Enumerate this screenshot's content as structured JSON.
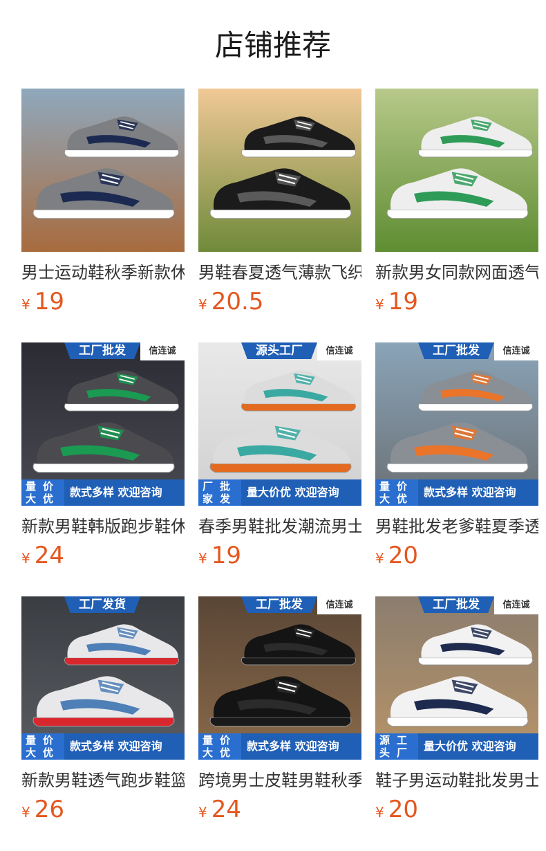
{
  "title": "店铺推荐",
  "currency": "¥",
  "colors": {
    "price": "#e4571f",
    "badge": "#1f5fb6"
  },
  "products": [
    {
      "name": "男士运动鞋秋季新款休闲跑步鞋",
      "price": "19",
      "badge_top": "",
      "badge_trust": "",
      "badge_left": "",
      "badge_right": "",
      "scene": "mountain",
      "shoe": "navy-grey"
    },
    {
      "name": "男鞋春夏透气薄款飞织运动鞋",
      "price": "20.5",
      "badge_top": "",
      "badge_trust": "",
      "badge_left": "",
      "badge_right": "",
      "scene": "sunset",
      "shoe": "black-white"
    },
    {
      "name": "新款男女同款网面透气运动鞋",
      "price": "19",
      "badge_top": "",
      "badge_trust": "",
      "badge_left": "",
      "badge_right": "",
      "scene": "grass",
      "shoe": "white-green"
    },
    {
      "name": "新款男鞋韩版跑步鞋休闲运动鞋",
      "price": "24",
      "badge_top": "工厂批发",
      "badge_trust": "信连诚",
      "badge_left": "量价大优",
      "badge_right": "款式多样 欢迎咨询",
      "scene": "dark",
      "shoe": "grey-green"
    },
    {
      "name": "春季男鞋批发潮流男士运动鞋",
      "price": "19",
      "badge_top": "源头工厂",
      "badge_trust": "信连诚",
      "badge_left": "厂批家发",
      "badge_right": "量大价优 欢迎咨询",
      "scene": "studio",
      "shoe": "grey-teal"
    },
    {
      "name": "男鞋批发老爹鞋夏季透气网面鞋",
      "price": "20",
      "badge_top": "工厂批发",
      "badge_trust": "信连诚",
      "badge_left": "量价大优",
      "badge_right": "款式多样 欢迎咨询",
      "scene": "city",
      "shoe": "grey-orange"
    },
    {
      "name": "新款男鞋透气跑步鞋篮球运动鞋",
      "price": "26",
      "badge_top": "工厂发货",
      "badge_trust": "",
      "badge_left": "量价大优",
      "badge_right": "款式多样 欢迎咨询",
      "scene": "studio-dark",
      "shoe": "camo-red"
    },
    {
      "name": "跨境男士皮鞋男鞋秋季商务休闲鞋",
      "price": "24",
      "badge_top": "工厂批发",
      "badge_trust": "信连诚",
      "badge_left": "量价大优",
      "badge_right": "款式多样 欢迎咨询",
      "scene": "wood",
      "shoe": "leather"
    },
    {
      "name": "鞋子男运动鞋批发男士休闲鞋",
      "price": "20",
      "badge_top": "工厂批发",
      "badge_trust": "信连诚",
      "badge_left": "源工头厂",
      "badge_right": "量大价优 欢迎咨询",
      "scene": "city2",
      "shoe": "white-navy"
    }
  ]
}
